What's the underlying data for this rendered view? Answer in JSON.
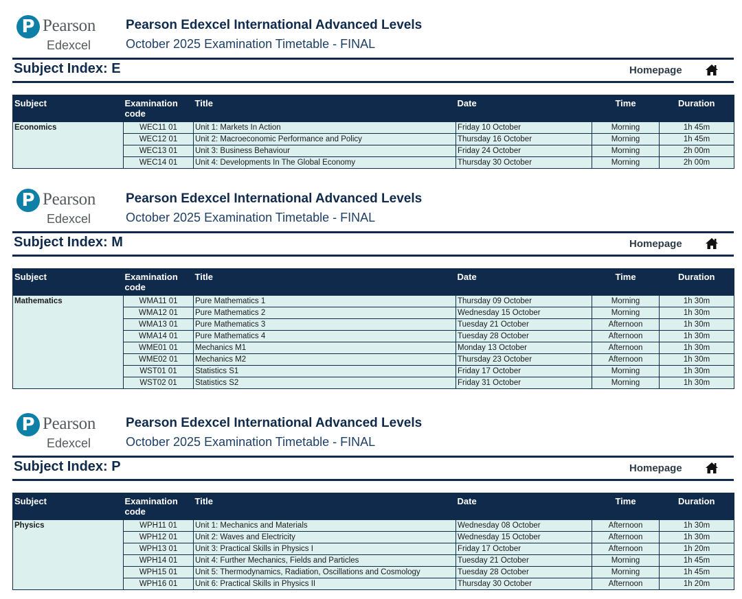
{
  "header": {
    "logo_word": "Pearson",
    "logo_sub": "Edexcel",
    "title": "Pearson Edexcel International Advanced Levels",
    "subtitle": "October 2025 Examination Timetable - FINAL"
  },
  "homepage_label": "Homepage",
  "columns": {
    "subject": "Subject",
    "code_line1": "Examination",
    "code_line2": "code",
    "title": "Title",
    "date": "Date",
    "time": "Time",
    "duration": "Duration"
  },
  "sections": [
    {
      "index_title": "Subject Index: E",
      "subject": "Economics",
      "rows": [
        {
          "code": "WEC11 01",
          "title": "Unit 1: Markets In Action",
          "date": "Friday 10 October",
          "time": "Morning",
          "duration": "1h 45m"
        },
        {
          "code": "WEC12 01",
          "title": "Unit 2: Macroeconomic Performance and Policy",
          "date": "Thursday 16 October",
          "time": "Morning",
          "duration": "1h 45m"
        },
        {
          "code": "WEC13 01",
          "title": "Unit 3: Business Behaviour",
          "date": "Friday 24 October",
          "time": "Morning",
          "duration": "2h 00m"
        },
        {
          "code": "WEC14 01",
          "title": "Unit 4: Developments In The Global Economy",
          "date": "Thursday 30 October",
          "time": "Morning",
          "duration": "2h 00m"
        }
      ]
    },
    {
      "index_title": "Subject Index: M",
      "subject": "Mathematics",
      "rows": [
        {
          "code": "WMA11 01",
          "title": "Pure Mathematics 1",
          "date": "Thursday 09 October",
          "time": "Morning",
          "duration": "1h 30m"
        },
        {
          "code": "WMA12 01",
          "title": "Pure Mathematics 2",
          "date": "Wednesday 15 October",
          "time": "Morning",
          "duration": "1h 30m"
        },
        {
          "code": "WMA13 01",
          "title": "Pure Mathematics 3",
          "date": "Tuesday 21 October",
          "time": "Afternoon",
          "duration": "1h 30m"
        },
        {
          "code": "WMA14 01",
          "title": "Pure Mathematics 4",
          "date": "Tuesday 28 October",
          "time": "Afternoon",
          "duration": "1h 30m"
        },
        {
          "code": "WME01 01",
          "title": "Mechanics M1",
          "date": "Monday 13 October",
          "time": "Afternoon",
          "duration": "1h 30m"
        },
        {
          "code": "WME02 01",
          "title": "Mechanics M2",
          "date": "Thursday 23 October",
          "time": "Afternoon",
          "duration": "1h 30m"
        },
        {
          "code": "WST01 01",
          "title": "Statistics S1",
          "date": "Friday 17 October",
          "time": "Morning",
          "duration": "1h 30m"
        },
        {
          "code": "WST02 01",
          "title": "Statistics S2",
          "date": "Friday 31 October",
          "time": "Morning",
          "duration": "1h 30m"
        }
      ]
    },
    {
      "index_title": "Subject Index: P",
      "subject": "Physics",
      "rows": [
        {
          "code": "WPH11 01",
          "title": "Unit 1: Mechanics and Materials",
          "date": "Wednesday 08 October",
          "time": "Afternoon",
          "duration": "1h 30m"
        },
        {
          "code": "WPH12 01",
          "title": "Unit 2: Waves and Electricity",
          "date": "Wednesday 15 October",
          "time": "Afternoon",
          "duration": "1h 30m"
        },
        {
          "code": "WPH13 01",
          "title": "Unit 3: Practical Skills in Physics I",
          "date": "Friday 17 October",
          "time": "Afternoon",
          "duration": "1h 20m"
        },
        {
          "code": "WPH14 01",
          "title": "Unit 4: Further Mechanics, Fields and Particles",
          "date": "Tuesday 21 October",
          "time": "Morning",
          "duration": "1h 45m"
        },
        {
          "code": "WPH15 01",
          "title": "Unit 5: Thermodynamics, Radiation, Oscillations and Cosmology",
          "date": "Tuesday 28 October",
          "time": "Morning",
          "duration": "1h 45m"
        },
        {
          "code": "WPH16 01",
          "title": "Unit 6: Practical Skills in Physics II",
          "date": "Thursday 30 October",
          "time": "Afternoon",
          "duration": "1h 20m"
        }
      ]
    }
  ]
}
